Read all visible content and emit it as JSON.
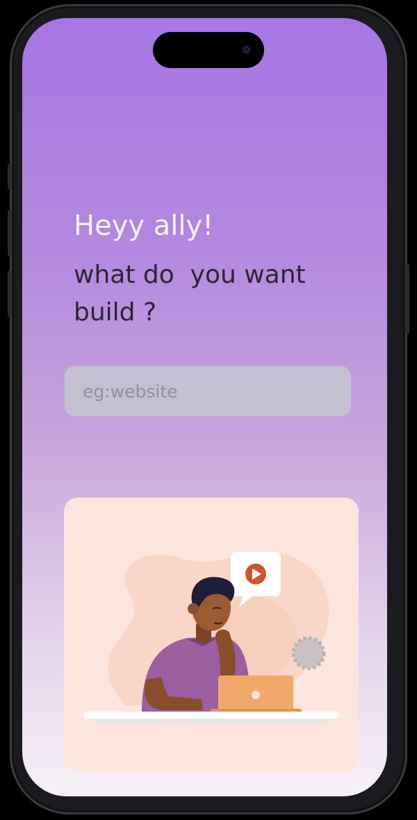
{
  "screen": {
    "greeting": "Heyy ally!",
    "question": "what do  you want\nbuild ?"
  },
  "search": {
    "placeholder": "eg:website",
    "value": ""
  },
  "illustration": {
    "subject": "person-thinking-at-laptop",
    "bubble_icon": "play-icon"
  },
  "colors": {
    "gradient_top": "#a676e4",
    "gradient_bottom": "#f6f1f6",
    "card_background": "#fbe5dd",
    "play_button": "#c9592b",
    "shirt": "#9c5fa0",
    "laptop": "#f0a96b"
  }
}
